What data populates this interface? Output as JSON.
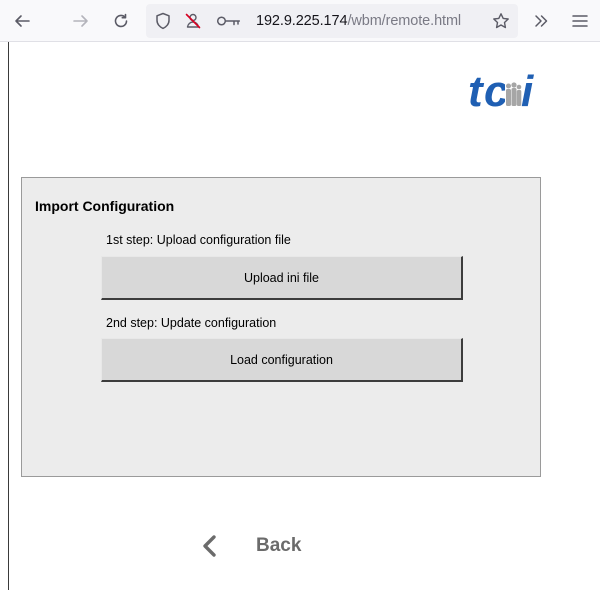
{
  "browser": {
    "url_host": "192.9.225.174",
    "url_path": "/wbm/remote.html"
  },
  "brand": {
    "logo_text": "tci",
    "color": "#1f5fb3"
  },
  "panel": {
    "title": "Import Configuration",
    "step1_label": "1st step: Upload configuration file",
    "step1_button": "Upload ini file",
    "step2_label": "2nd step: Update configuration",
    "step2_button": "Load configuration"
  },
  "footer": {
    "back_label": "Back"
  },
  "icons": {
    "back": "arrow-left-icon",
    "forward": "arrow-right-icon",
    "reload": "reload-icon",
    "tracking": "shield-icon",
    "permissions": "blocked-permission-icon",
    "key": "key-icon",
    "bookmark": "star-icon",
    "overflow": "chevron-double-right-icon",
    "menu": "hamburger-menu-icon",
    "page_back": "chevron-left-icon"
  }
}
